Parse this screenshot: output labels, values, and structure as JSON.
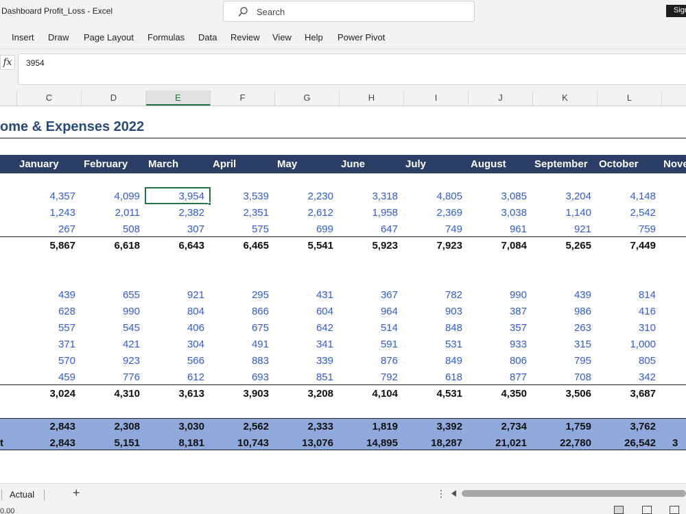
{
  "window": {
    "title": "Dashboard Profit_Loss  -  Excel",
    "search_placeholder": "Search",
    "sign_in": "Sign in"
  },
  "ribbon": {
    "tabs": [
      "Insert",
      "Draw",
      "Page Layout",
      "Formulas",
      "Data",
      "Review",
      "View",
      "Help",
      "Power Pivot"
    ]
  },
  "formula_bar": {
    "fx": "fx",
    "value": "3954"
  },
  "columns": [
    "C",
    "D",
    "E",
    "F",
    "G",
    "H",
    "I",
    "J",
    "K",
    "L"
  ],
  "selected_column": "E",
  "sheet": {
    "title": "ome & Expenses 2022",
    "months": [
      "January",
      "February",
      "March",
      "April",
      "May",
      "June",
      "July",
      "August",
      "September",
      "October",
      "Nove"
    ],
    "income_rows": [
      [
        "4,357",
        "4,099",
        "3,954",
        "3,539",
        "2,230",
        "3,318",
        "4,805",
        "3,085",
        "3,204",
        "4,148"
      ],
      [
        "1,243",
        "2,011",
        "2,382",
        "2,351",
        "2,612",
        "1,958",
        "2,369",
        "3,038",
        "1,140",
        "2,542"
      ],
      [
        "267",
        "508",
        "307",
        "575",
        "699",
        "647",
        "749",
        "961",
        "921",
        "759"
      ]
    ],
    "income_total": [
      "5,867",
      "6,618",
      "6,643",
      "6,465",
      "5,541",
      "5,923",
      "7,923",
      "7,084",
      "5,265",
      "7,449"
    ],
    "expense_rows": [
      [
        "439",
        "655",
        "921",
        "295",
        "431",
        "367",
        "782",
        "990",
        "439",
        "814"
      ],
      [
        "628",
        "990",
        "804",
        "866",
        "604",
        "964",
        "903",
        "387",
        "986",
        "416"
      ],
      [
        "557",
        "545",
        "406",
        "675",
        "642",
        "514",
        "848",
        "357",
        "263",
        "310"
      ],
      [
        "371",
        "421",
        "304",
        "491",
        "341",
        "591",
        "531",
        "933",
        "315",
        "1,000"
      ],
      [
        "570",
        "923",
        "566",
        "883",
        "339",
        "876",
        "849",
        "806",
        "795",
        "805"
      ],
      [
        "459",
        "776",
        "612",
        "693",
        "851",
        "792",
        "618",
        "877",
        "708",
        "342"
      ]
    ],
    "expense_total": [
      "3,024",
      "4,310",
      "3,613",
      "3,903",
      "3,208",
      "4,104",
      "4,531",
      "4,350",
      "3,506",
      "3,687"
    ],
    "net_row": [
      "2,843",
      "2,308",
      "3,030",
      "2,562",
      "2,333",
      "1,819",
      "3,392",
      "2,734",
      "1,759",
      "3,762"
    ],
    "cumulative_label": "t",
    "cumulative_row": [
      "2,843",
      "5,151",
      "8,181",
      "10,743",
      "13,076",
      "14,895",
      "18,287",
      "21,021",
      "22,780",
      "26,542"
    ],
    "cumulative_extra": "3"
  },
  "sheet_tabs": {
    "active": "Actual",
    "add": "+",
    "more": "⋮"
  },
  "status_bar": {
    "text": "0.00"
  }
}
